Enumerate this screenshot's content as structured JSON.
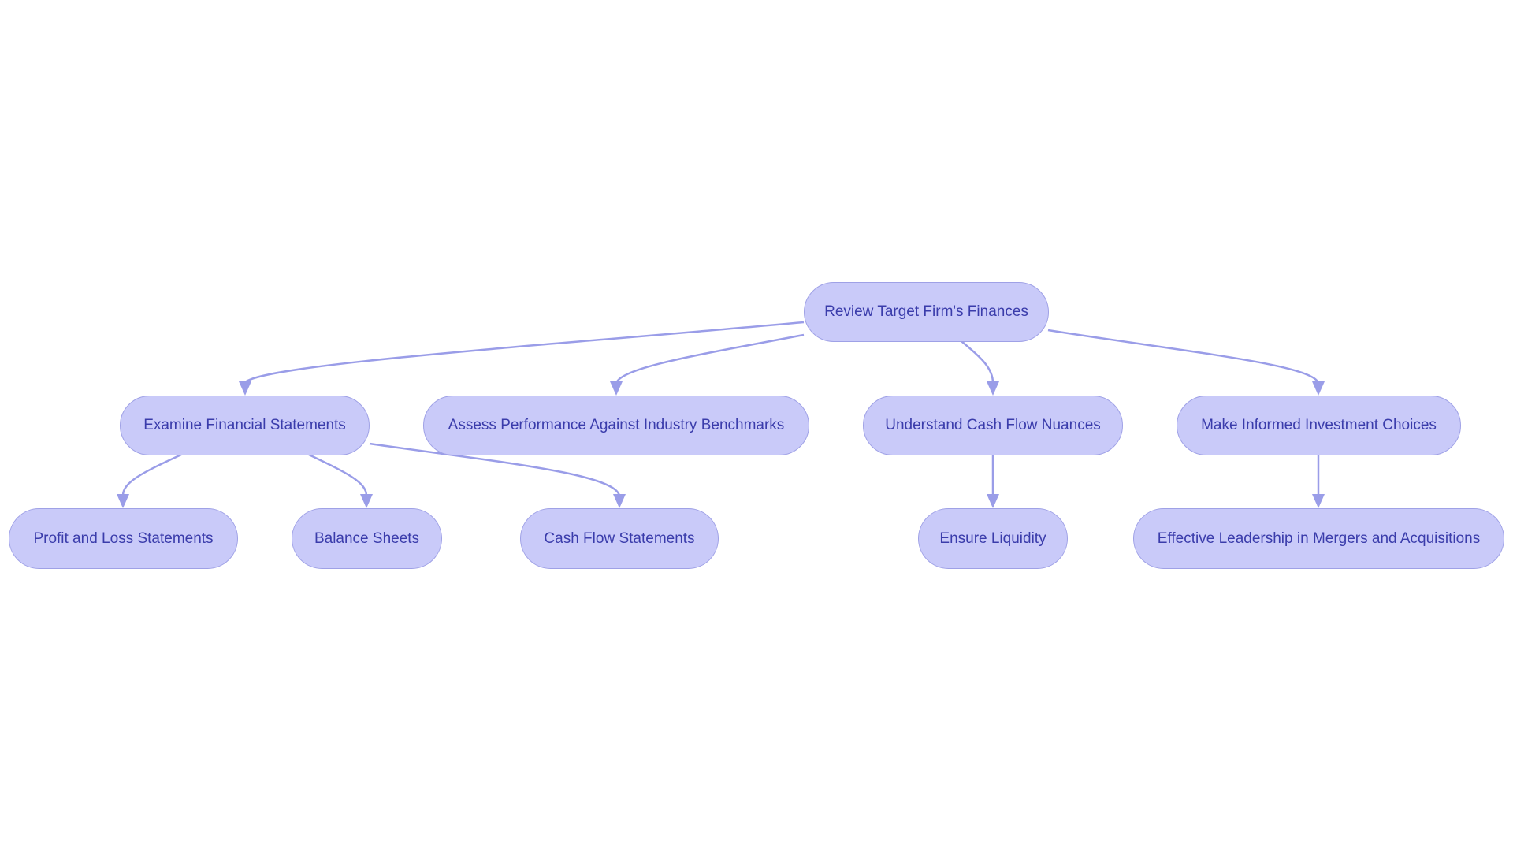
{
  "diagram": {
    "type": "flowchart",
    "colors": {
      "node_fill": "#c9caf9",
      "node_stroke": "#9fa1e6",
      "text": "#3a3cab",
      "edge": "#9a9de8"
    },
    "nodes": {
      "root": "Review Target Firm's Finances",
      "examine": "Examine Financial Statements",
      "assess": "Assess Performance Against Industry Benchmarks",
      "understand": "Understand Cash Flow Nuances",
      "make": "Make Informed Investment Choices",
      "profit": "Profit and Loss Statements",
      "balance": "Balance Sheets",
      "cashflow": "Cash Flow Statements",
      "ensure": "Ensure Liquidity",
      "effective": "Effective Leadership in Mergers and Acquisitions"
    },
    "edges": [
      [
        "root",
        "examine"
      ],
      [
        "root",
        "assess"
      ],
      [
        "root",
        "understand"
      ],
      [
        "root",
        "make"
      ],
      [
        "examine",
        "profit"
      ],
      [
        "examine",
        "balance"
      ],
      [
        "examine",
        "cashflow"
      ],
      [
        "understand",
        "ensure"
      ],
      [
        "make",
        "effective"
      ]
    ]
  }
}
